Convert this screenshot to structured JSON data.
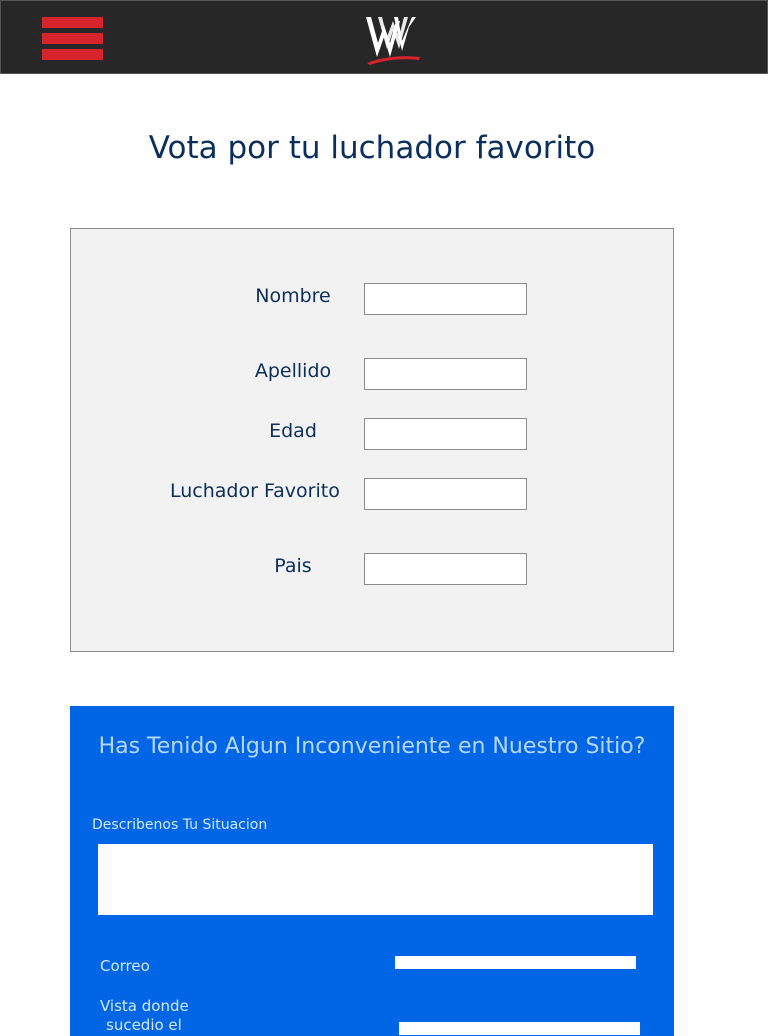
{
  "header": {
    "menu_icon": "hamburger-menu-icon",
    "logo_icon": "wwe-logo-icon",
    "colors": {
      "bar": "#272727",
      "menu": "#d6232d"
    }
  },
  "page_title": "Vota por tu luchador favorito",
  "vote_form": {
    "fields": [
      {
        "label": "Nombre",
        "value": ""
      },
      {
        "label": "Apellido",
        "value": ""
      },
      {
        "label": "Edad",
        "value": ""
      },
      {
        "label": "Luchador Favorito",
        "value": ""
      },
      {
        "label": "Pais",
        "value": ""
      }
    ]
  },
  "help_section": {
    "title": "Has Tenido Algun Inconveniente en Nuestro Sitio?",
    "description_label": "Describenos Tu Situacion",
    "email_label": "Correo",
    "view_label_line1": "Vista donde",
    "view_label_line2": "sucedio el",
    "color": "#0066e6"
  }
}
